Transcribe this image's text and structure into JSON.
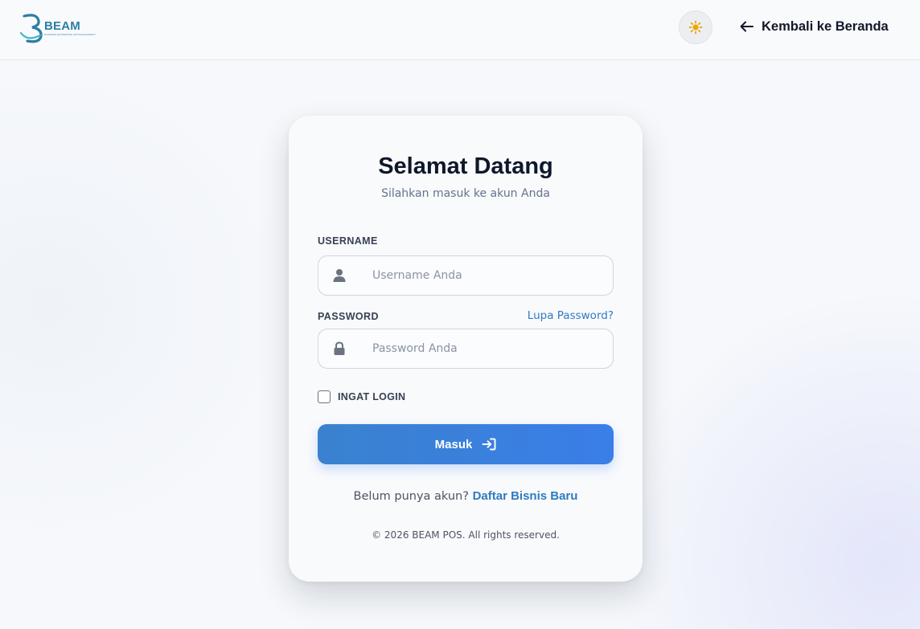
{
  "header": {
    "logo_text": "BEAM",
    "logo_tagline": "BUSINESS ENTERPRISE APP MANAGEMENT",
    "theme_icon": "sun-icon",
    "back_label": "Kembali ke Beranda"
  },
  "login": {
    "title": "Selamat Datang",
    "subtitle": "Silahkan masuk ke akun Anda",
    "username_label": "USERNAME",
    "username_placeholder": "Username Anda",
    "username_value": "",
    "password_label": "PASSWORD",
    "password_placeholder": "Password Anda",
    "password_value": "",
    "forgot_label": "Lupa Password?",
    "remember_label": "INGAT LOGIN",
    "remember_checked": false,
    "submit_label": "Masuk",
    "signup_prompt": "Belum punya akun?",
    "signup_link": "Daftar Bisnis Baru",
    "copyright": "© 2026 BEAM POS. All rights reserved."
  },
  "colors": {
    "accent": "#3a7ee8",
    "link": "#2f7bbf",
    "sun": "#f0a500",
    "brand": "#2d7ea3"
  }
}
